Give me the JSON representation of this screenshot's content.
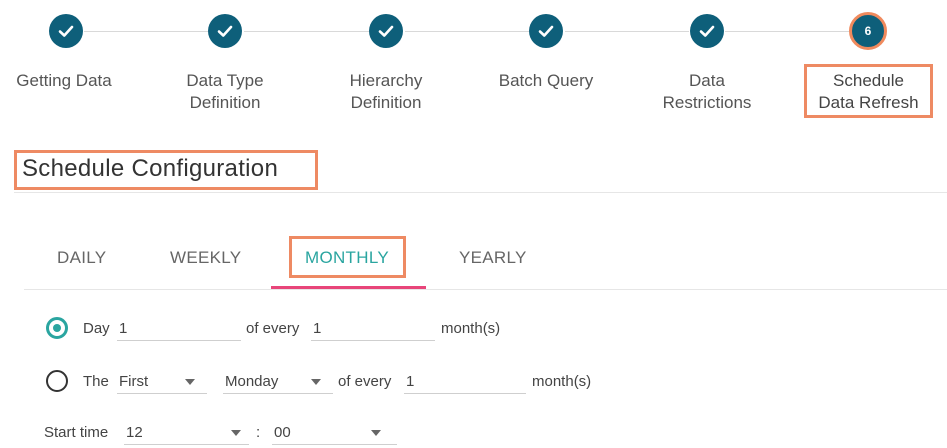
{
  "stepper": {
    "steps": [
      {
        "label": "Getting Data"
      },
      {
        "label": "Data Type\nDefinition"
      },
      {
        "label": "Hierarchy\nDefinition"
      },
      {
        "label": "Batch Query"
      },
      {
        "label": "Data\nRestrictions"
      },
      {
        "label": "Schedule\nData Refresh",
        "number": "6"
      }
    ]
  },
  "page": {
    "title": "Schedule Configuration"
  },
  "tabs": [
    "DAILY",
    "WEEKLY",
    "MONTHLY",
    "YEARLY"
  ],
  "options": {
    "day": {
      "label": "Day",
      "day_value": "1",
      "of_every": "of every",
      "every_value": "1",
      "unit": "month(s)"
    },
    "the": {
      "label": "The",
      "ordinal": "First",
      "weekday": "Monday",
      "of_every": "of every",
      "every_value": "1",
      "unit": "month(s)"
    }
  },
  "start_time": {
    "label": "Start time",
    "hour": "12",
    "separator": ":",
    "minute": "00"
  },
  "colors": {
    "accent": "#2aa5a0",
    "step": "#0e5f7a",
    "highlight": "#ee8a63",
    "underline": "#e8457a"
  }
}
